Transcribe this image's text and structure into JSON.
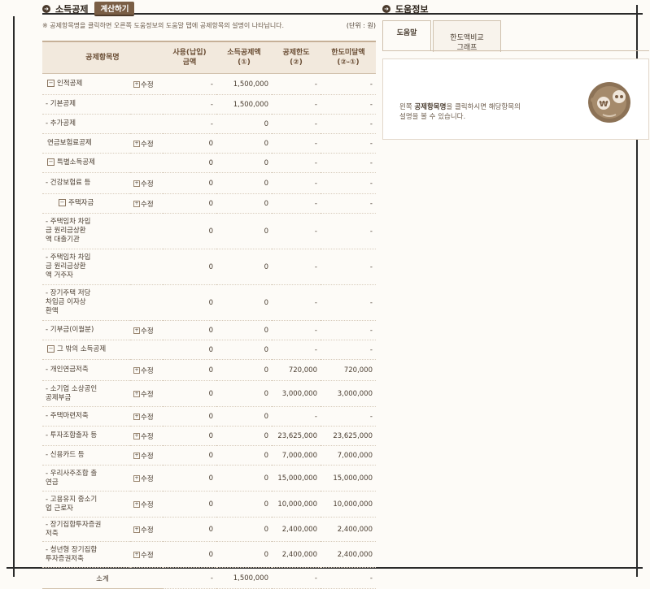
{
  "left": {
    "title": "소득공제",
    "calc_button": "계산하기",
    "notice": "※ 공제항목명을 클릭하면 오른쪽 도움정보의 도움말 탭에 공제항목의 설명이 나타납니다.",
    "unit": "(단위 : 원)",
    "headers": {
      "item": "공제항목명",
      "paid": "사용(납입)\n금액",
      "deduct": "소득공제액\n(①)",
      "limit": "공제한도\n(②)",
      "under": "한도미달액\n(②-①)"
    },
    "edit_label": "수정",
    "rows": [
      {
        "name": "인적공제",
        "lvl": 0,
        "box": "−",
        "edit": true,
        "paid": "-",
        "deduct": "1,500,000",
        "limit": "-",
        "under": "-"
      },
      {
        "name": "- 기본공제",
        "lvl": 1,
        "edit": false,
        "paid": "-",
        "deduct": "1,500,000",
        "limit": "-",
        "under": "-"
      },
      {
        "name": "- 추가공제",
        "lvl": 1,
        "edit": false,
        "paid": "-",
        "deduct": "0",
        "limit": "-",
        "under": "-"
      },
      {
        "name": "연금보험료공제",
        "lvl": -1,
        "edit": true,
        "paid": "0",
        "deduct": "0",
        "limit": "-",
        "under": "-"
      },
      {
        "name": "특별소득공제",
        "lvl": 0,
        "box": "−",
        "edit": false,
        "paid": "0",
        "deduct": "0",
        "limit": "-",
        "under": "-"
      },
      {
        "name": "- 건강보험료 등",
        "lvl": 1,
        "edit": true,
        "paid": "0",
        "deduct": "0",
        "limit": "-",
        "under": "-"
      },
      {
        "name": "주택자금",
        "lvl": 2,
        "box": "−",
        "edit": true,
        "paid": "0",
        "deduct": "0",
        "limit": "-",
        "under": "-"
      },
      {
        "name": "- 주택임차 차입\n금 원리금상환\n액 대출기관",
        "lvl": 3,
        "edit": false,
        "paid": "0",
        "deduct": "0",
        "limit": "-",
        "under": "-"
      },
      {
        "name": "- 주택임차 차입\n금 원리금상환\n액 거주자",
        "lvl": 3,
        "edit": false,
        "paid": "0",
        "deduct": "0",
        "limit": "-",
        "under": "-"
      },
      {
        "name": "- 장기주택 저당\n차입금 이자상\n환액",
        "lvl": 3,
        "edit": false,
        "paid": "0",
        "deduct": "0",
        "limit": "-",
        "under": "-"
      },
      {
        "name": "- 기부금(이월분)",
        "lvl": 1,
        "edit": true,
        "paid": "0",
        "deduct": "0",
        "limit": "-",
        "under": "-"
      },
      {
        "name": "그 밖의 소득공제",
        "lvl": 0,
        "box": "−",
        "edit": false,
        "paid": "0",
        "deduct": "0",
        "limit": "-",
        "under": "-"
      },
      {
        "name": "- 개인연금저축",
        "lvl": 1,
        "edit": true,
        "paid": "0",
        "deduct": "0",
        "limit": "720,000",
        "under": "720,000"
      },
      {
        "name": "- 소기업 소상공인\n공제부금",
        "lvl": 1,
        "edit": true,
        "paid": "0",
        "deduct": "0",
        "limit": "3,000,000",
        "under": "3,000,000"
      },
      {
        "name": "- 주택마련저축",
        "lvl": 1,
        "edit": true,
        "paid": "0",
        "deduct": "0",
        "limit": "-",
        "under": "-"
      },
      {
        "name": "- 투자조합출자 등",
        "lvl": 1,
        "edit": true,
        "paid": "0",
        "deduct": "0",
        "limit": "23,625,000",
        "under": "23,625,000"
      },
      {
        "name": "- 신용카드 등",
        "lvl": 1,
        "edit": true,
        "paid": "0",
        "deduct": "0",
        "limit": "7,000,000",
        "under": "7,000,000"
      },
      {
        "name": "- 우리사주조합 출\n연금",
        "lvl": 1,
        "edit": true,
        "paid": "0",
        "deduct": "0",
        "limit": "15,000,000",
        "under": "15,000,000"
      },
      {
        "name": "- 고용유지 중소기\n업 근로자",
        "lvl": 1,
        "edit": true,
        "paid": "0",
        "deduct": "0",
        "limit": "10,000,000",
        "under": "10,000,000"
      },
      {
        "name": "- 장기집합투자증권\n저축",
        "lvl": 1,
        "edit": true,
        "paid": "0",
        "deduct": "0",
        "limit": "2,400,000",
        "under": "2,400,000"
      },
      {
        "name": "- 청년형 장기집합\n투자증권저축",
        "lvl": 1,
        "edit": true,
        "paid": "0",
        "deduct": "0",
        "limit": "2,400,000",
        "under": "2,400,000"
      }
    ],
    "total": {
      "label": "소계",
      "paid": "-",
      "deduct": "1,500,000",
      "limit": "-",
      "under": "-"
    }
  },
  "help": {
    "title": "도움정보",
    "tab_help": "도움말",
    "tab_graph": "한도액비교\n그래프",
    "text_pre": "왼쪽 ",
    "text_bold": "공제항목명",
    "text_post": "을 클릭하시면 해당항목의\n설명을 볼 수 있습니다."
  }
}
